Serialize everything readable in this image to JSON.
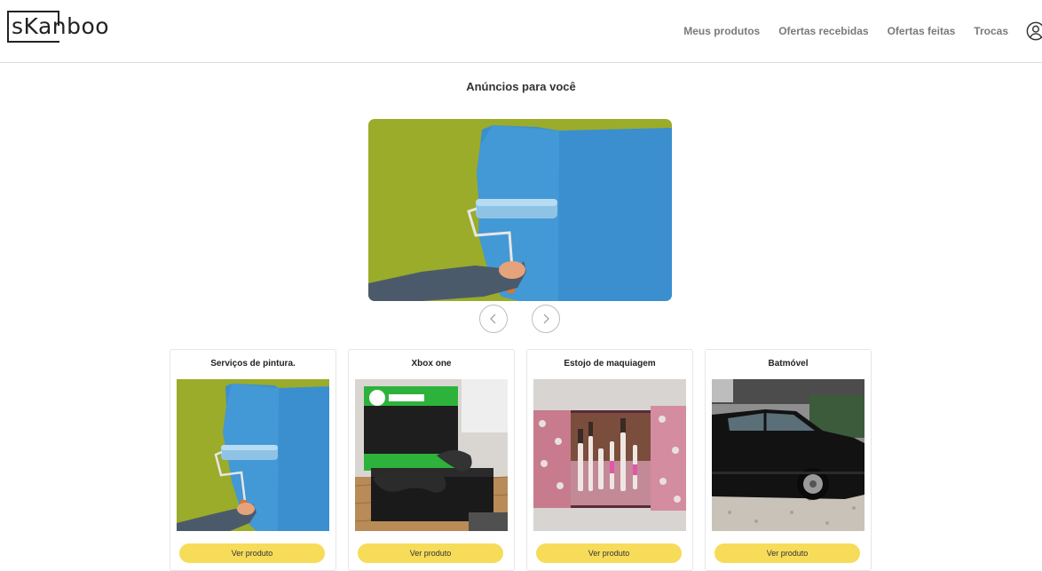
{
  "header": {
    "logo": "sKanboo",
    "nav": [
      "Meus produtos",
      "Ofertas recebidas",
      "Ofertas feitas",
      "Trocas"
    ],
    "user_icon": "user-icon"
  },
  "section_title": "Anúncios para você",
  "carousel": {
    "current_image": "paint-roller-wall",
    "prev_icon": "chevron-left-icon",
    "next_icon": "chevron-right-icon"
  },
  "products": [
    {
      "title": "Serviços de pintura.",
      "image": "paint-roller-wall",
      "button": "Ver produto"
    },
    {
      "title": "Xbox one",
      "image": "xbox-console",
      "button": "Ver produto"
    },
    {
      "title": "Estojo de maquiagem",
      "image": "makeup-case",
      "button": "Ver produto"
    },
    {
      "title": "Batmóvel",
      "image": "black-car",
      "button": "Ver produto"
    }
  ],
  "colors": {
    "accent_button": "#f7dc5a",
    "nav_text": "#7a7a7a",
    "wall_green": "#9aac2a",
    "wall_blue": "#3b8fcf"
  }
}
